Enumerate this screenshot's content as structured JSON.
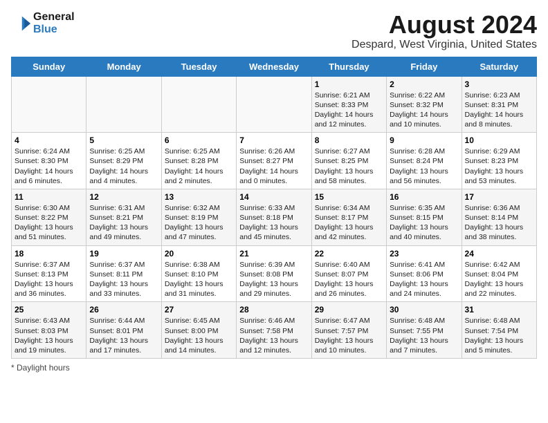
{
  "header": {
    "logo_line1": "General",
    "logo_line2": "Blue",
    "title": "August 2024",
    "subtitle": "Despard, West Virginia, United States"
  },
  "days_of_week": [
    "Sunday",
    "Monday",
    "Tuesday",
    "Wednesday",
    "Thursday",
    "Friday",
    "Saturday"
  ],
  "footer": {
    "label": "Daylight hours"
  },
  "weeks": [
    [
      {
        "day": "",
        "info": ""
      },
      {
        "day": "",
        "info": ""
      },
      {
        "day": "",
        "info": ""
      },
      {
        "day": "",
        "info": ""
      },
      {
        "day": "1",
        "info": "Sunrise: 6:21 AM\nSunset: 8:33 PM\nDaylight: 14 hours and 12 minutes."
      },
      {
        "day": "2",
        "info": "Sunrise: 6:22 AM\nSunset: 8:32 PM\nDaylight: 14 hours and 10 minutes."
      },
      {
        "day": "3",
        "info": "Sunrise: 6:23 AM\nSunset: 8:31 PM\nDaylight: 14 hours and 8 minutes."
      }
    ],
    [
      {
        "day": "4",
        "info": "Sunrise: 6:24 AM\nSunset: 8:30 PM\nDaylight: 14 hours and 6 minutes."
      },
      {
        "day": "5",
        "info": "Sunrise: 6:25 AM\nSunset: 8:29 PM\nDaylight: 14 hours and 4 minutes."
      },
      {
        "day": "6",
        "info": "Sunrise: 6:25 AM\nSunset: 8:28 PM\nDaylight: 14 hours and 2 minutes."
      },
      {
        "day": "7",
        "info": "Sunrise: 6:26 AM\nSunset: 8:27 PM\nDaylight: 14 hours and 0 minutes."
      },
      {
        "day": "8",
        "info": "Sunrise: 6:27 AM\nSunset: 8:25 PM\nDaylight: 13 hours and 58 minutes."
      },
      {
        "day": "9",
        "info": "Sunrise: 6:28 AM\nSunset: 8:24 PM\nDaylight: 13 hours and 56 minutes."
      },
      {
        "day": "10",
        "info": "Sunrise: 6:29 AM\nSunset: 8:23 PM\nDaylight: 13 hours and 53 minutes."
      }
    ],
    [
      {
        "day": "11",
        "info": "Sunrise: 6:30 AM\nSunset: 8:22 PM\nDaylight: 13 hours and 51 minutes."
      },
      {
        "day": "12",
        "info": "Sunrise: 6:31 AM\nSunset: 8:21 PM\nDaylight: 13 hours and 49 minutes."
      },
      {
        "day": "13",
        "info": "Sunrise: 6:32 AM\nSunset: 8:19 PM\nDaylight: 13 hours and 47 minutes."
      },
      {
        "day": "14",
        "info": "Sunrise: 6:33 AM\nSunset: 8:18 PM\nDaylight: 13 hours and 45 minutes."
      },
      {
        "day": "15",
        "info": "Sunrise: 6:34 AM\nSunset: 8:17 PM\nDaylight: 13 hours and 42 minutes."
      },
      {
        "day": "16",
        "info": "Sunrise: 6:35 AM\nSunset: 8:15 PM\nDaylight: 13 hours and 40 minutes."
      },
      {
        "day": "17",
        "info": "Sunrise: 6:36 AM\nSunset: 8:14 PM\nDaylight: 13 hours and 38 minutes."
      }
    ],
    [
      {
        "day": "18",
        "info": "Sunrise: 6:37 AM\nSunset: 8:13 PM\nDaylight: 13 hours and 36 minutes."
      },
      {
        "day": "19",
        "info": "Sunrise: 6:37 AM\nSunset: 8:11 PM\nDaylight: 13 hours and 33 minutes."
      },
      {
        "day": "20",
        "info": "Sunrise: 6:38 AM\nSunset: 8:10 PM\nDaylight: 13 hours and 31 minutes."
      },
      {
        "day": "21",
        "info": "Sunrise: 6:39 AM\nSunset: 8:08 PM\nDaylight: 13 hours and 29 minutes."
      },
      {
        "day": "22",
        "info": "Sunrise: 6:40 AM\nSunset: 8:07 PM\nDaylight: 13 hours and 26 minutes."
      },
      {
        "day": "23",
        "info": "Sunrise: 6:41 AM\nSunset: 8:06 PM\nDaylight: 13 hours and 24 minutes."
      },
      {
        "day": "24",
        "info": "Sunrise: 6:42 AM\nSunset: 8:04 PM\nDaylight: 13 hours and 22 minutes."
      }
    ],
    [
      {
        "day": "25",
        "info": "Sunrise: 6:43 AM\nSunset: 8:03 PM\nDaylight: 13 hours and 19 minutes."
      },
      {
        "day": "26",
        "info": "Sunrise: 6:44 AM\nSunset: 8:01 PM\nDaylight: 13 hours and 17 minutes."
      },
      {
        "day": "27",
        "info": "Sunrise: 6:45 AM\nSunset: 8:00 PM\nDaylight: 13 hours and 14 minutes."
      },
      {
        "day": "28",
        "info": "Sunrise: 6:46 AM\nSunset: 7:58 PM\nDaylight: 13 hours and 12 minutes."
      },
      {
        "day": "29",
        "info": "Sunrise: 6:47 AM\nSunset: 7:57 PM\nDaylight: 13 hours and 10 minutes."
      },
      {
        "day": "30",
        "info": "Sunrise: 6:48 AM\nSunset: 7:55 PM\nDaylight: 13 hours and 7 minutes."
      },
      {
        "day": "31",
        "info": "Sunrise: 6:48 AM\nSunset: 7:54 PM\nDaylight: 13 hours and 5 minutes."
      }
    ]
  ]
}
